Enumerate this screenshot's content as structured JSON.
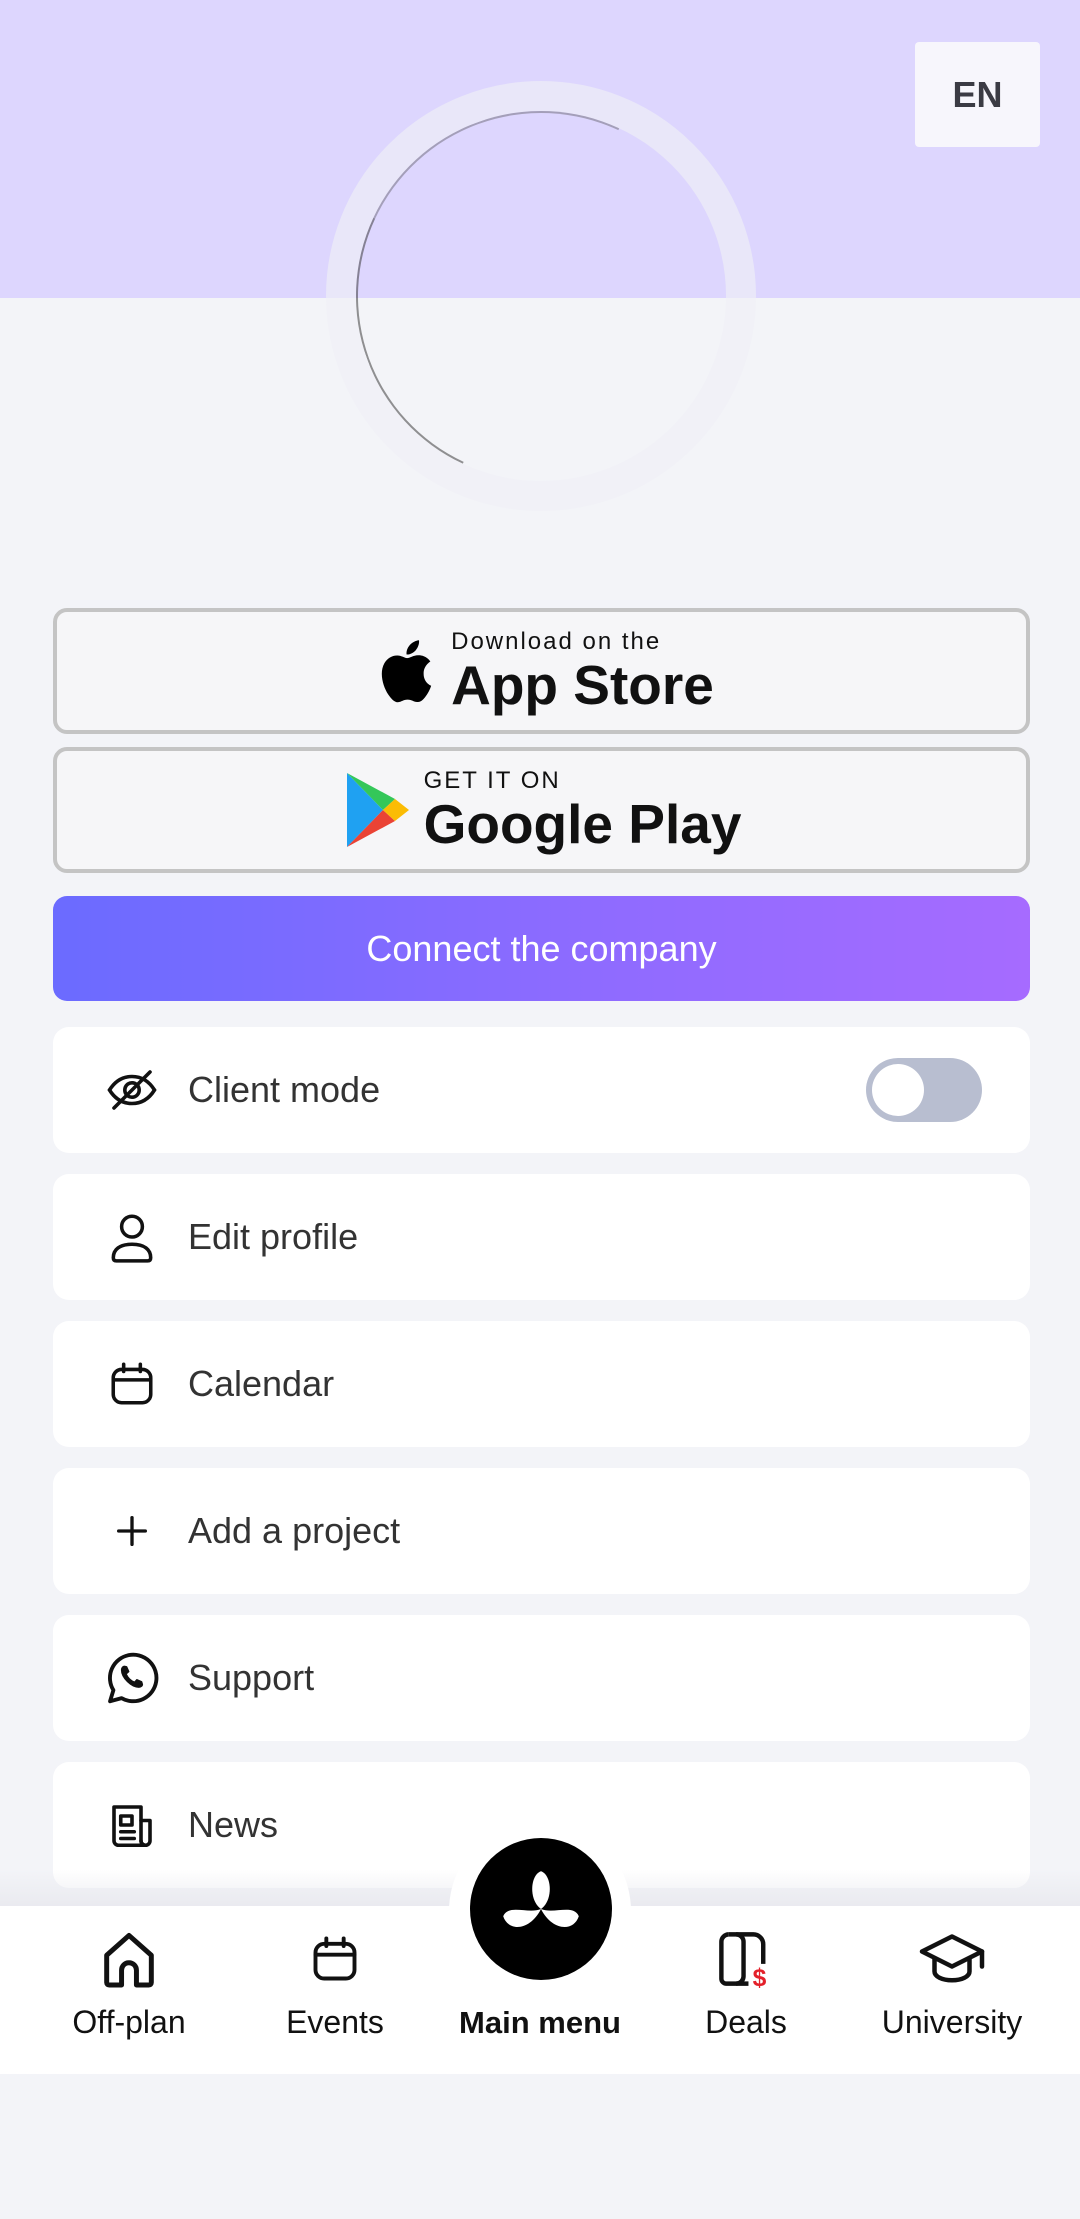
{
  "header": {
    "language": "EN",
    "band_color": "#ddd6fe"
  },
  "stores": {
    "apple": {
      "small": "Download on the",
      "big": "App Store",
      "icon": "apple-logo-icon"
    },
    "google": {
      "small": "GET IT ON",
      "big": "Google Play",
      "icon": "google-play-icon"
    }
  },
  "connect": {
    "label": "Connect the company"
  },
  "menu": {
    "items": [
      {
        "label": "Client mode",
        "icon": "eye-off-icon",
        "toggle": false
      },
      {
        "label": "Edit profile",
        "icon": "user-icon"
      },
      {
        "label": "Calendar",
        "icon": "calendar-icon"
      },
      {
        "label": "Add a project",
        "icon": "plus-icon"
      },
      {
        "label": "Support",
        "icon": "whatsapp-icon"
      },
      {
        "label": "News",
        "icon": "newspaper-icon"
      }
    ]
  },
  "nav": {
    "items": [
      {
        "label": "Off-plan",
        "icon": "home-icon"
      },
      {
        "label": "Events",
        "icon": "calendar-icon"
      },
      {
        "label": "Main menu",
        "icon": "propeller-logo-icon"
      },
      {
        "label": "Deals",
        "icon": "deals-document-icon"
      },
      {
        "label": "University",
        "icon": "graduation-cap-icon"
      }
    ]
  },
  "colors": {
    "accent_start": "#6b6bff",
    "accent_end": "#a66bff",
    "toggle_off": "#b8bed0",
    "deal_red": "#e3202a"
  }
}
